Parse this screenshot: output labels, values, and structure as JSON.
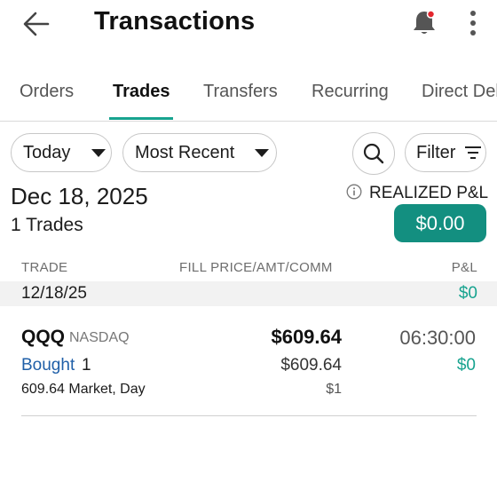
{
  "header": {
    "title": "Transactions",
    "accent_color": "#17a38f",
    "notification_dot_color": "#e3262e"
  },
  "tabs": [
    {
      "label": "Orders",
      "active": false
    },
    {
      "label": "Trades",
      "active": true
    },
    {
      "label": "Transfers",
      "active": false
    },
    {
      "label": "Recurring",
      "active": false
    },
    {
      "label": "Direct Del",
      "active": false
    }
  ],
  "filters": {
    "period": "Today",
    "sort": "Most Recent",
    "filter_label": "Filter"
  },
  "summary": {
    "date": "Dec 18, 2025",
    "trade_count": "1 Trades",
    "realized_pl_label": "REALIZED P&L",
    "realized_pl_value": "$0.00"
  },
  "table": {
    "headers": {
      "trade": "TRADE",
      "fill": "FILL PRICE/AMT/COMM",
      "pl": "P&L"
    },
    "groups": [
      {
        "date": "12/18/25",
        "pl": "$0",
        "rows": [
          {
            "symbol": "QQQ",
            "exchange": "NASDAQ",
            "fill_price": "$609.64",
            "time": "06:30:00",
            "side": "Bought",
            "quantity": "1",
            "amount": "$609.64",
            "pl": "$0",
            "order_desc": "609.64 Market, Day",
            "commission": "$1"
          }
        ]
      }
    ]
  }
}
